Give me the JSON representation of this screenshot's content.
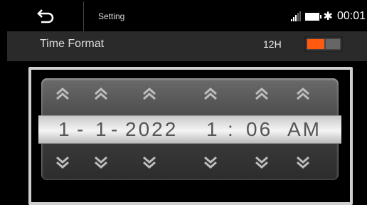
{
  "header": {
    "title": "Setting",
    "time": "00:01"
  },
  "time_format": {
    "label": "Time Format",
    "value": "12H",
    "toggle_on": true
  },
  "picker": {
    "month": "1",
    "sep1": "-",
    "day": "1",
    "sep2": "-",
    "year": "2022",
    "hour": "1",
    "colon": ":",
    "minute": "06",
    "ampm": "AM"
  },
  "colors": {
    "accent": "#ff5a10",
    "background": "#000000",
    "frame": "#cfcfcf"
  },
  "icons": [
    "back-icon",
    "signal-icon",
    "battery-icon",
    "bluetooth-icon",
    "chevron-up-icon",
    "chevron-down-icon"
  ]
}
